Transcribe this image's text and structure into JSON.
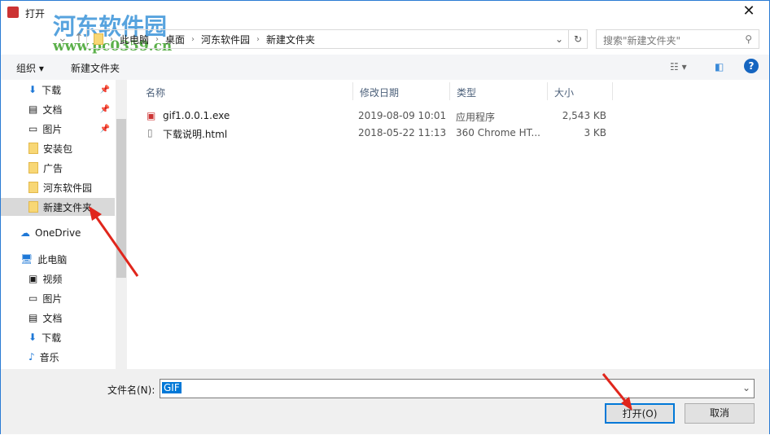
{
  "title": "打开",
  "watermark": {
    "name": "河东软件园",
    "url": "www.pc0359.cn"
  },
  "breadcrumb": [
    "此电脑",
    "桌面",
    "河东软件园",
    "新建文件夹"
  ],
  "search_placeholder": "搜索\"新建文件夹\"",
  "toolbar": {
    "organize": "组织 ▾",
    "new_folder": "新建文件夹"
  },
  "sidebar": [
    {
      "label": "下载",
      "pinned": true
    },
    {
      "label": "文档",
      "pinned": true
    },
    {
      "label": "图片",
      "pinned": true
    },
    {
      "label": "安装包"
    },
    {
      "label": "广告"
    },
    {
      "label": "河东软件园"
    },
    {
      "label": "新建文件夹",
      "selected": true
    },
    {
      "label": "OneDrive"
    },
    {
      "label": "此电脑"
    },
    {
      "label": "视频"
    },
    {
      "label": "图片"
    },
    {
      "label": "文档"
    },
    {
      "label": "下载"
    },
    {
      "label": "音乐"
    }
  ],
  "columns": [
    "名称",
    "修改日期",
    "类型",
    "大小"
  ],
  "files": [
    {
      "name": "gif1.0.0.1.exe",
      "date": "2019-08-09 10:01",
      "type": "应用程序",
      "size": "2,543 KB"
    },
    {
      "name": "下载说明.html",
      "date": "2018-05-22 11:13",
      "type": "360 Chrome HT...",
      "size": "3 KB"
    }
  ],
  "filename_label": "文件名(N):",
  "filename_value": "GIF",
  "open_label": "打开(O)",
  "cancel_label": "取消"
}
